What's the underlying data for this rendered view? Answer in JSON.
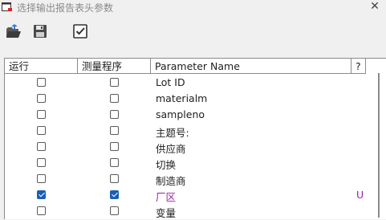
{
  "window": {
    "title": "选择输出报告表头参数",
    "close_glyph": "✕",
    "icon": "app-window-icon"
  },
  "toolbar": {
    "buttons": [
      {
        "icon": "open-folder-icon"
      },
      {
        "icon": "save-icon"
      },
      {
        "icon": "check-all-icon"
      }
    ]
  },
  "grid": {
    "columns": {
      "run": "运行",
      "measure": "测量程序",
      "param": "Parameter Name",
      "q": "?"
    },
    "rows": [
      {
        "run": false,
        "measure": false,
        "name": "Lot ID",
        "flag": ""
      },
      {
        "run": false,
        "measure": false,
        "name": "materialm",
        "flag": ""
      },
      {
        "run": false,
        "measure": false,
        "name": "sampleno",
        "flag": ""
      },
      {
        "run": false,
        "measure": false,
        "name": "主题号:",
        "flag": ""
      },
      {
        "run": false,
        "measure": false,
        "name": "供应商",
        "flag": ""
      },
      {
        "run": false,
        "measure": false,
        "name": "切换",
        "flag": ""
      },
      {
        "run": false,
        "measure": false,
        "name": "制造商",
        "flag": ""
      },
      {
        "run": true,
        "measure": true,
        "name": "厂区",
        "flag": "U"
      },
      {
        "run": false,
        "measure": false,
        "name": "变量",
        "flag": ""
      }
    ],
    "accent_color": "#1a5fb4",
    "active_text_color": "#9b1fa8"
  }
}
